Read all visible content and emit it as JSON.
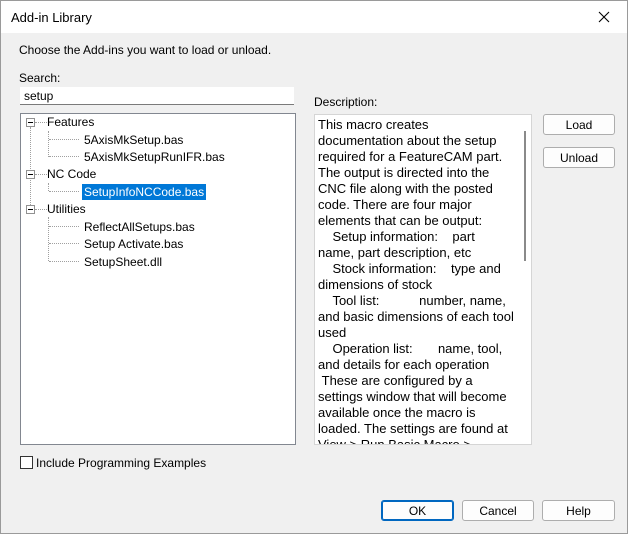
{
  "window": {
    "title": "Add-in Library"
  },
  "instructions": "Choose the Add-ins you want to load or unload.",
  "search": {
    "label": "Search:",
    "value": "setup"
  },
  "tree": {
    "groups": [
      {
        "label": "Features",
        "items": [
          "5AxisMkSetup.bas",
          "5AxisMkSetupRunIFR.bas"
        ]
      },
      {
        "label": "NC Code",
        "items": [
          "SetupInfoNCCode.bas"
        ]
      },
      {
        "label": "Utilities",
        "items": [
          "ReflectAllSetups.bas",
          "Setup Activate.bas",
          "SetupSheet.dll"
        ]
      }
    ],
    "selected": "SetupInfoNCCode.bas"
  },
  "description": {
    "label": "Description:",
    "text": "This macro creates documentation about the setup required for a FeatureCAM part. The output is directed into the CNC file along with the posted code. There are four major elements that can be output:\n    Setup information:    part name, part description, etc\n    Stock information:    type and dimensions of stock\n    Tool list:           number, name, and basic dimensions of each tool used\n    Operation list:       name, tool, and details for each operation\n These are configured by a settings window that will become available once the macro is loaded. The settings are found at View > Run Basic Macro > SetupInfoNCCode"
  },
  "side_buttons": {
    "load": "Load",
    "unload": "Unload"
  },
  "include_examples": {
    "label": "Include Programming Examples",
    "checked": false
  },
  "footer": {
    "ok": "OK",
    "cancel": "Cancel",
    "help": "Help"
  }
}
